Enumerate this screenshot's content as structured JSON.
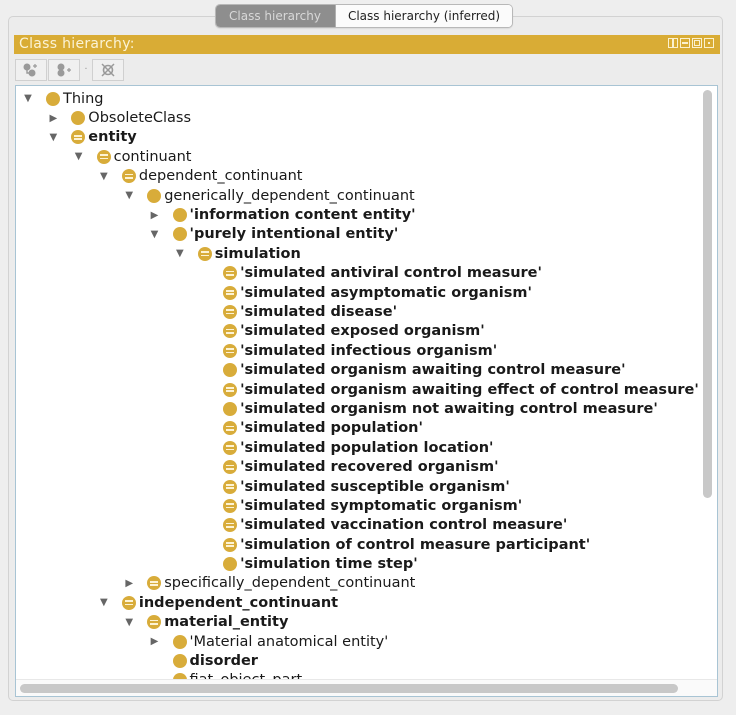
{
  "tabs": [
    {
      "label": "Class hierarchy",
      "active": true
    },
    {
      "label": "Class hierarchy (inferred)",
      "active": false
    }
  ],
  "view": {
    "title": "Class hierarchy:",
    "controls": [
      "split-icon",
      "minimize-icon",
      "maximize-icon",
      "close-icon"
    ],
    "header_color": "#d9ac35"
  },
  "toolbar": {
    "buttons": [
      {
        "name": "add-subclass-button",
        "icon": "add-subclass-icon"
      },
      {
        "name": "add-sibling-class-button",
        "icon": "add-sibling-class-icon"
      },
      {
        "name": "delete-class-button",
        "icon": "delete-class-icon"
      }
    ]
  },
  "tree": {
    "icon_color": "#d8ac3a",
    "nodes": [
      {
        "label": "Thing",
        "depth": 0,
        "toggle": "expanded",
        "icon": "primitive",
        "bold": false
      },
      {
        "label": "ObsoleteClass",
        "depth": 1,
        "toggle": "collapsed",
        "icon": "primitive",
        "bold": false
      },
      {
        "label": "entity",
        "depth": 1,
        "toggle": "expanded",
        "icon": "defined",
        "bold": true
      },
      {
        "label": "continuant",
        "depth": 2,
        "toggle": "expanded",
        "icon": "defined",
        "bold": false
      },
      {
        "label": "dependent_continuant",
        "depth": 3,
        "toggle": "expanded",
        "icon": "defined",
        "bold": false
      },
      {
        "label": "generically_dependent_continuant",
        "depth": 4,
        "toggle": "expanded",
        "icon": "primitive",
        "bold": false
      },
      {
        "label": "'information content entity'",
        "depth": 5,
        "toggle": "collapsed",
        "icon": "primitive",
        "bold": true
      },
      {
        "label": "'purely intentional entity'",
        "depth": 5,
        "toggle": "expanded",
        "icon": "primitive",
        "bold": true
      },
      {
        "label": "simulation",
        "depth": 6,
        "toggle": "expanded",
        "icon": "defined",
        "bold": true
      },
      {
        "label": "'simulated antiviral control measure'",
        "depth": 7,
        "toggle": "none",
        "icon": "defined",
        "bold": true
      },
      {
        "label": "'simulated asymptomatic organism'",
        "depth": 7,
        "toggle": "none",
        "icon": "defined",
        "bold": true
      },
      {
        "label": "'simulated disease'",
        "depth": 7,
        "toggle": "none",
        "icon": "defined",
        "bold": true
      },
      {
        "label": "'simulated exposed organism'",
        "depth": 7,
        "toggle": "none",
        "icon": "defined",
        "bold": true
      },
      {
        "label": "'simulated infectious organism'",
        "depth": 7,
        "toggle": "none",
        "icon": "defined",
        "bold": true
      },
      {
        "label": "'simulated organism awaiting control measure'",
        "depth": 7,
        "toggle": "none",
        "icon": "primitive",
        "bold": true
      },
      {
        "label": "'simulated organism awaiting effect of control measure'",
        "depth": 7,
        "toggle": "none",
        "icon": "defined",
        "bold": true
      },
      {
        "label": "'simulated organism not awaiting control measure'",
        "depth": 7,
        "toggle": "none",
        "icon": "primitive",
        "bold": true
      },
      {
        "label": "'simulated population'",
        "depth": 7,
        "toggle": "none",
        "icon": "defined",
        "bold": true
      },
      {
        "label": "'simulated population location'",
        "depth": 7,
        "toggle": "none",
        "icon": "defined",
        "bold": true
      },
      {
        "label": "'simulated recovered organism'",
        "depth": 7,
        "toggle": "none",
        "icon": "defined",
        "bold": true
      },
      {
        "label": "'simulated susceptible organism'",
        "depth": 7,
        "toggle": "none",
        "icon": "defined",
        "bold": true
      },
      {
        "label": "'simulated symptomatic organism'",
        "depth": 7,
        "toggle": "none",
        "icon": "defined",
        "bold": true
      },
      {
        "label": "'simulated vaccination control measure'",
        "depth": 7,
        "toggle": "none",
        "icon": "defined",
        "bold": true
      },
      {
        "label": "'simulation of control measure participant'",
        "depth": 7,
        "toggle": "none",
        "icon": "defined",
        "bold": true
      },
      {
        "label": "'simulation time step'",
        "depth": 7,
        "toggle": "none",
        "icon": "primitive",
        "bold": true
      },
      {
        "label": "specifically_dependent_continuant",
        "depth": 4,
        "toggle": "collapsed",
        "icon": "defined",
        "bold": false
      },
      {
        "label": "independent_continuant",
        "depth": 3,
        "toggle": "expanded",
        "icon": "defined",
        "bold": true
      },
      {
        "label": "material_entity",
        "depth": 4,
        "toggle": "expanded",
        "icon": "defined",
        "bold": true
      },
      {
        "label": "'Material anatomical entity'",
        "depth": 5,
        "toggle": "collapsed",
        "icon": "primitive",
        "bold": false
      },
      {
        "label": "disorder",
        "depth": 5,
        "toggle": "none",
        "icon": "primitive",
        "bold": true
      },
      {
        "label": "fiat_object_part",
        "depth": 5,
        "toggle": "none",
        "icon": "primitive",
        "bold": false
      }
    ]
  }
}
